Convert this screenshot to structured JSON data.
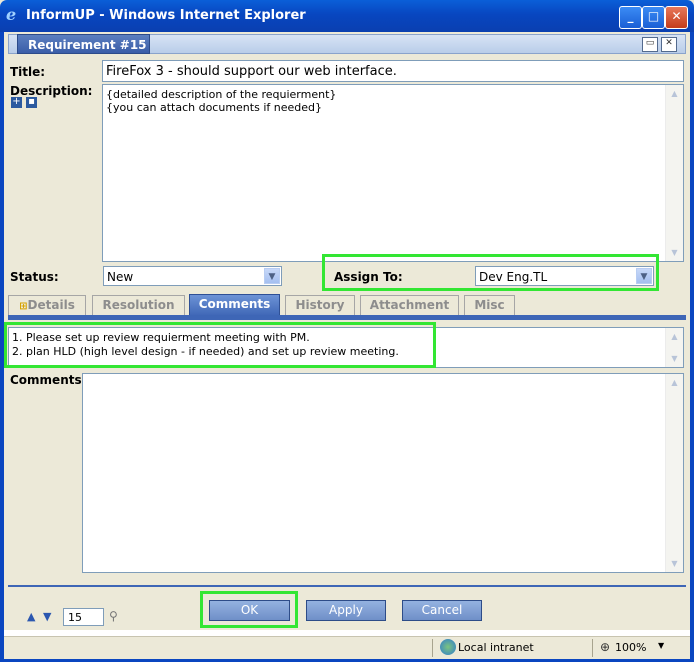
{
  "window": {
    "title": "InformUP - Windows Internet Explorer"
  },
  "header": {
    "tab_label": "Requirement #15"
  },
  "form": {
    "title_label": "Title:",
    "title_value": "FireFox 3 - should support our web interface.",
    "description_label": "Description:",
    "description_value": "{detailed description of the requierment}\n{you can attach documents if needed}",
    "status_label": "Status:",
    "status_value": "New",
    "assign_label": "Assign To:",
    "assign_value": "Dev Eng.TL"
  },
  "tabs": [
    {
      "label": "Details"
    },
    {
      "label": "Resolution"
    },
    {
      "label": "Comments"
    },
    {
      "label": "History"
    },
    {
      "label": "Attachment"
    },
    {
      "label": "Misc"
    }
  ],
  "active_tab": "Comments",
  "comments_panel": {
    "history_text": "1. Please set up review requierment meeting with PM.\n2. plan HLD (high level design - if needed) and set up review meeting.",
    "comments_label": "Comments:",
    "comments_value": ""
  },
  "footer": {
    "page_number": "15",
    "ok_label": "OK",
    "apply_label": "Apply",
    "cancel_label": "Cancel"
  },
  "statusbar": {
    "zone": "Local intranet",
    "zoom": "100%"
  },
  "colors": {
    "highlight": "#33e633",
    "titlebar": "#0a46c0",
    "active_tab": "#3e66b6"
  }
}
